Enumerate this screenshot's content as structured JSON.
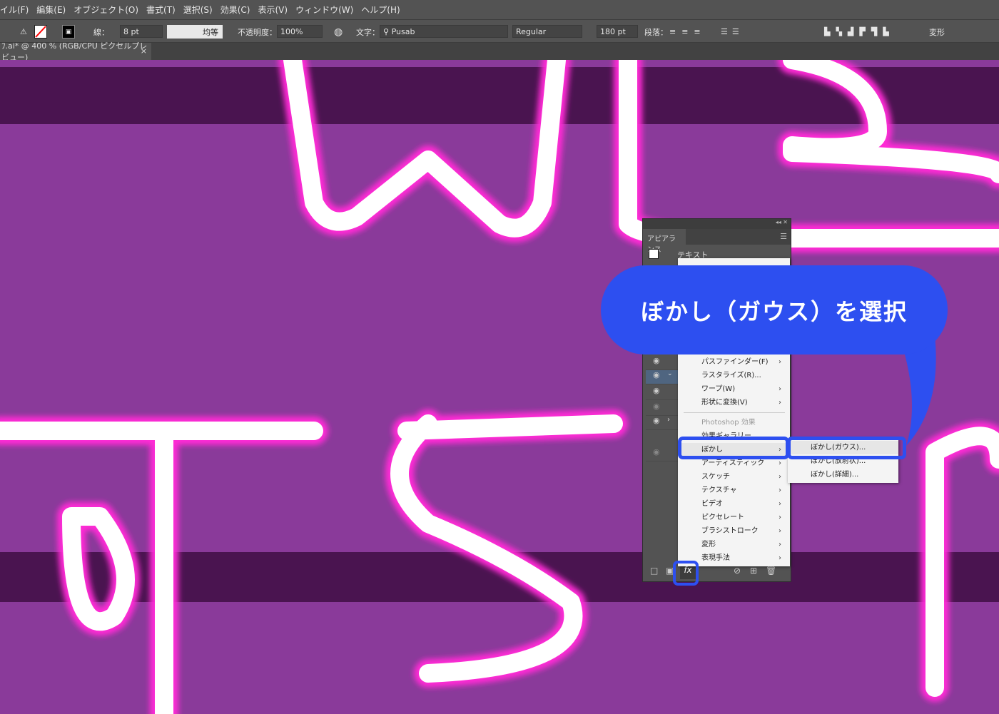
{
  "menubar": {
    "items": [
      "イル(F)",
      "編集(E)",
      "オブジェクト(O)",
      "書式(T)",
      "選択(S)",
      "効果(C)",
      "表示(V)",
      "ウィンドウ(W)",
      "ヘルプ(H)"
    ]
  },
  "toolbar": {
    "stroke_label": "線：",
    "stroke_weight": "8 pt",
    "stroke_profile": "均等",
    "opacity_label": "不透明度：",
    "opacity": "100%",
    "char_label": "文字：",
    "font": "Pusab",
    "font_style": "Regular",
    "font_size": "180 pt",
    "para_label": "段落：",
    "transform_label": "変形"
  },
  "document_tab": {
    "title": "ﾌ.ai* @ 400 % (RGB/CPU ピクセルプレビュー)",
    "close": "×"
  },
  "appearance_panel": {
    "tab": "アピアランス",
    "object_type": "テキスト"
  },
  "effect_menu": {
    "items": [
      {
        "label": "パスファインダー(F)",
        "submenu": true
      },
      {
        "label": "ラスタライズ(R)...",
        "submenu": false
      },
      {
        "label": "ワープ(W)",
        "submenu": true
      },
      {
        "label": "形状に変換(V)",
        "submenu": true
      },
      {
        "label": "Photoshop 効果",
        "header": true
      },
      {
        "label": "効果ギャラリー...",
        "submenu": false
      },
      {
        "label": "ぼかし",
        "submenu": true,
        "highlighted": true
      },
      {
        "label": "アーティスティック",
        "submenu": true
      },
      {
        "label": "スケッチ",
        "submenu": true
      },
      {
        "label": "テクスチャ",
        "submenu": true
      },
      {
        "label": "ビデオ",
        "submenu": true
      },
      {
        "label": "ピクセレート",
        "submenu": true
      },
      {
        "label": "ブラシストローク",
        "submenu": true
      },
      {
        "label": "変形",
        "submenu": true
      },
      {
        "label": "表現手法",
        "submenu": true
      }
    ]
  },
  "blur_submenu": {
    "items": [
      "ぼかし(ガウス)...",
      "ぼかし(放射状)...",
      "ぼかし(詳細)..."
    ]
  },
  "callout": {
    "text": "ぼかし（ガウス）を選択"
  },
  "colors": {
    "accent": "#2d4ff0",
    "canvas": "#8a3a9a",
    "neon": "#ff2bd6"
  }
}
